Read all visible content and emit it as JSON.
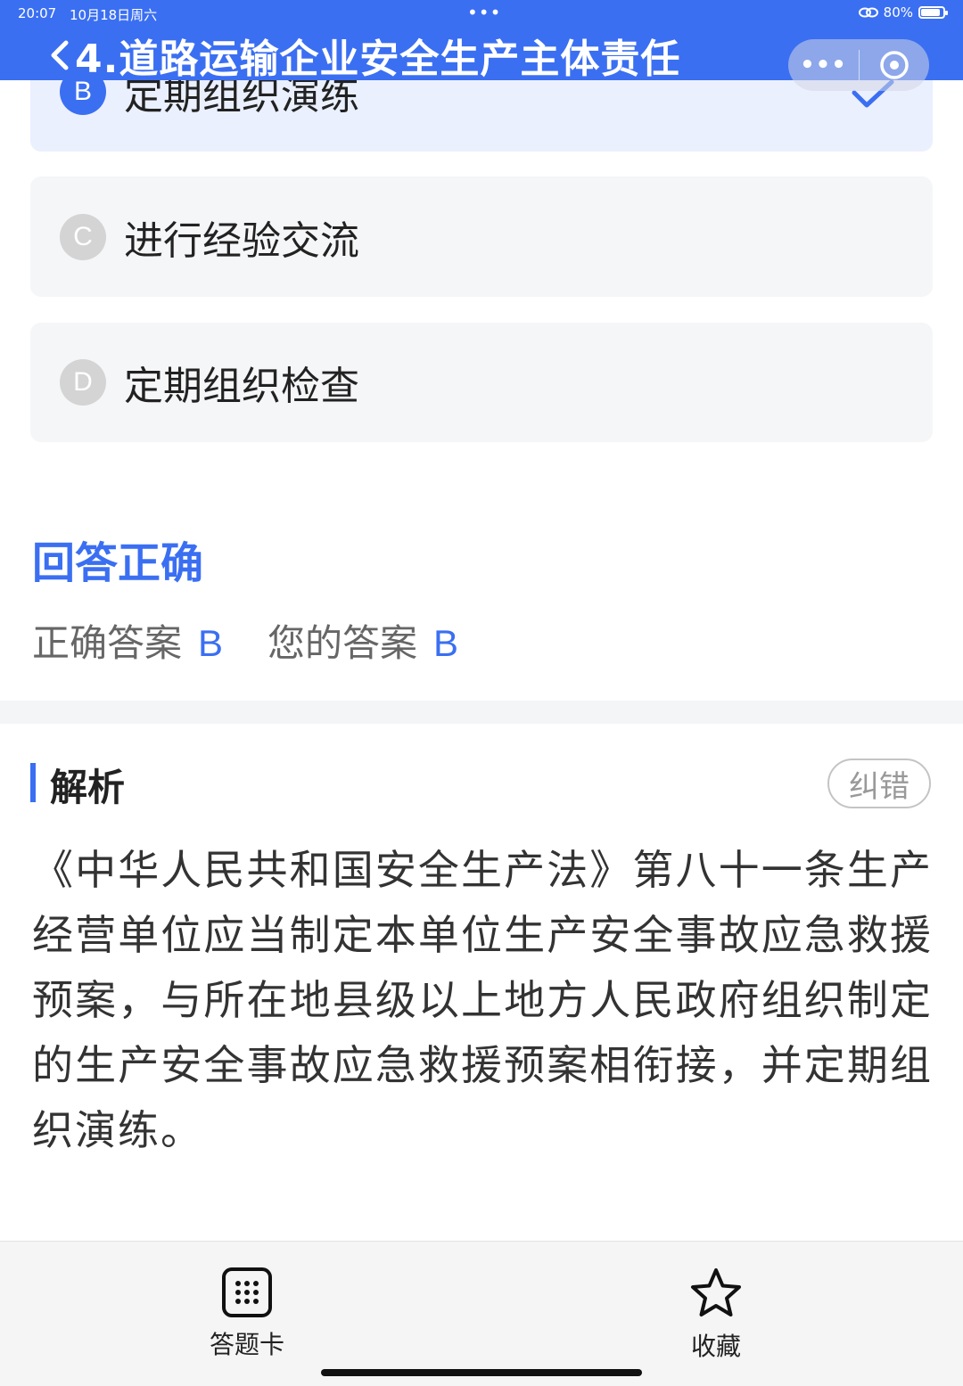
{
  "status_bar": {
    "time": "20:07",
    "date": "10月18日周六",
    "dots": "•••",
    "battery": "80%",
    "battery_level": 0.8
  },
  "header": {
    "title": "4.道路运输企业安全生产主体责任",
    "capsule_more": "•••"
  },
  "options": [
    {
      "letter": "B",
      "text": "定期组织演练",
      "selected": true
    },
    {
      "letter": "C",
      "text": "进行经验交流",
      "selected": false
    },
    {
      "letter": "D",
      "text": "定期组织检查",
      "selected": false
    }
  ],
  "result": {
    "title": "回答正确",
    "correct_label": "正确答案",
    "correct_value": "B",
    "yours_label": "您的答案",
    "yours_value": "B"
  },
  "analysis": {
    "title": "解析",
    "report_button": "纠错",
    "text": "《中华人民共和国安全生产法》第八十一条生产经营单位应当制定本单位生产安全事故应急救援预案，与所在地县级以上地方人民政府组织制定的生产安全事故应急救援预案相衔接，并定期组织演练。"
  },
  "bottom_bar": {
    "answer_card": "答题卡",
    "favorite": "收藏"
  },
  "colors": {
    "accent": "#3b6ff2",
    "selected_bg": "#eaf0fe",
    "option_bg": "#f5f6f8"
  }
}
